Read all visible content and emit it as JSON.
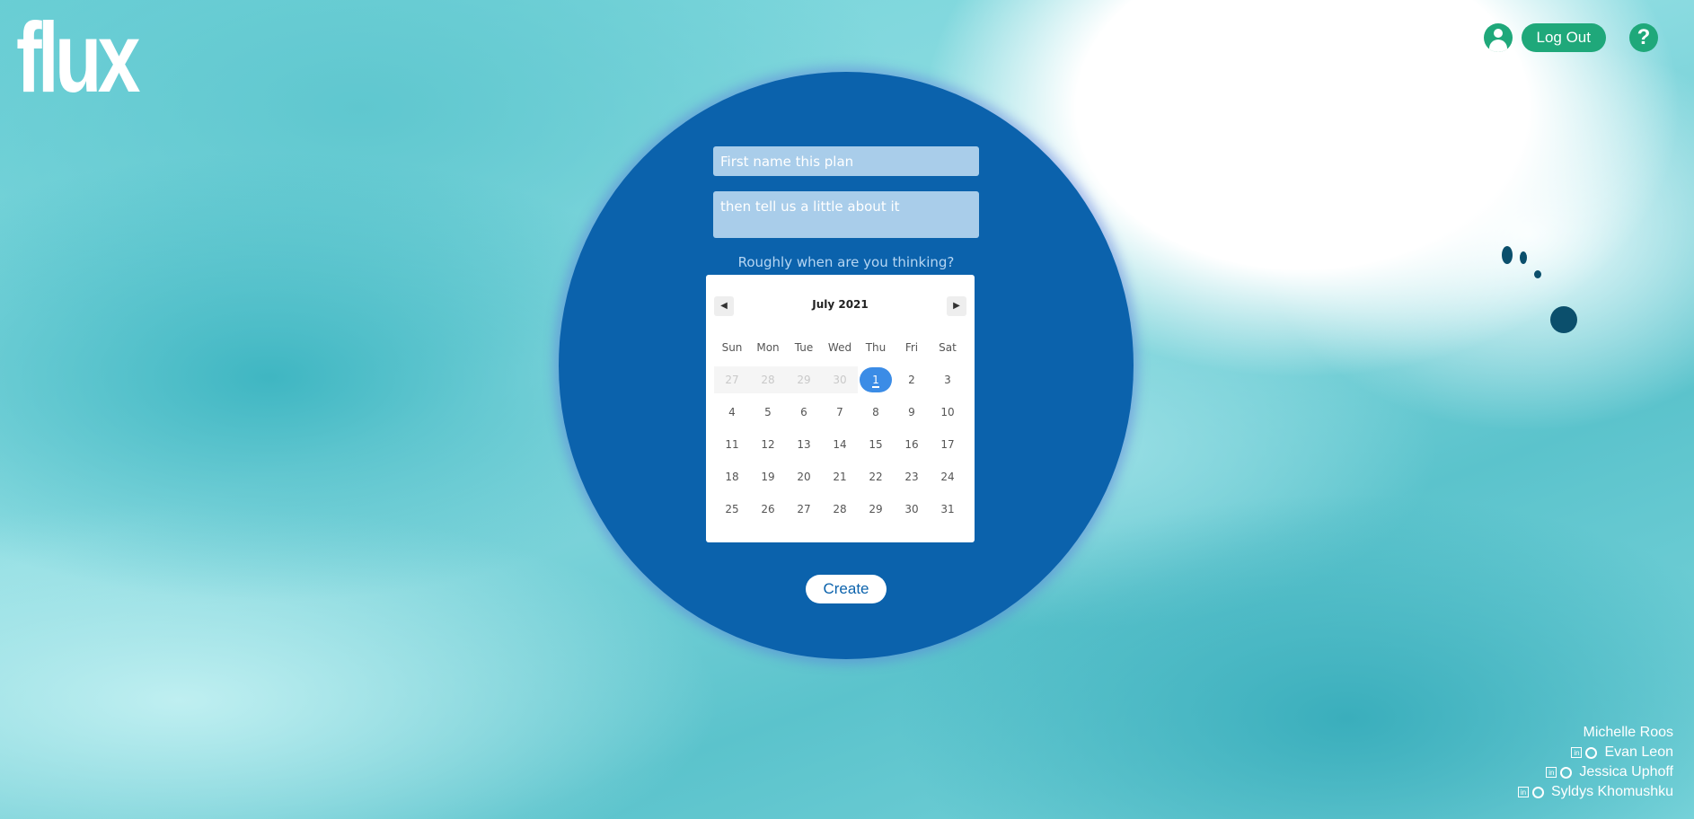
{
  "app": {
    "logo": "flux"
  },
  "topbar": {
    "logout_label": "Log Out",
    "help_label": "?"
  },
  "form": {
    "name_placeholder": "First name this plan",
    "description_placeholder": "then tell us a little about it",
    "date_prompt": "Roughly when are you thinking?",
    "create_label": "Create"
  },
  "calendar": {
    "month_label": "July 2021",
    "weekdays": [
      "Sun",
      "Mon",
      "Tue",
      "Wed",
      "Thu",
      "Fri",
      "Sat"
    ],
    "selected_day": "1",
    "weeks": [
      [
        "27",
        "28",
        "29",
        "30",
        "1",
        "2",
        "3"
      ],
      [
        "4",
        "5",
        "6",
        "7",
        "8",
        "9",
        "10"
      ],
      [
        "11",
        "12",
        "13",
        "14",
        "15",
        "16",
        "17"
      ],
      [
        "18",
        "19",
        "20",
        "21",
        "22",
        "23",
        "24"
      ],
      [
        "25",
        "26",
        "27",
        "28",
        "29",
        "30",
        "31"
      ]
    ],
    "outside_month": [
      [
        0,
        0
      ],
      [
        0,
        1
      ],
      [
        0,
        2
      ],
      [
        0,
        3
      ]
    ]
  },
  "credits": [
    "Michelle Roos",
    "Evan Leon",
    "Jessica Uphoff",
    "Syldys Khomushku"
  ],
  "colors": {
    "circle": "#0b62ac",
    "button_green": "#1fa87a",
    "selected_day": "#3b8ce6"
  }
}
